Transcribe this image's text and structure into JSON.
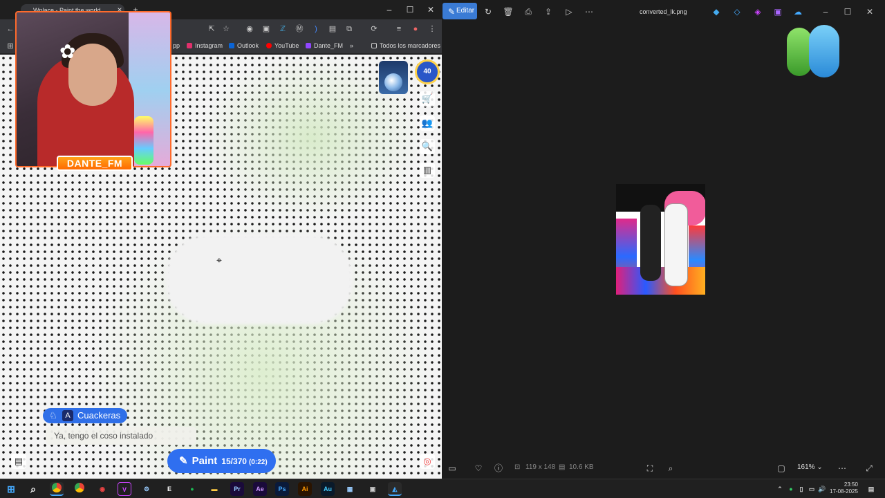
{
  "browser": {
    "tab_title": "Wplace - Paint the world",
    "bookmarks": [
      "Instagram",
      "Outlook",
      "YouTube",
      "Dante_FM"
    ],
    "all_bookmarks": "Todos los marcadores",
    "bookmark_partial": "pp"
  },
  "stream": {
    "streamer_label": "DANTE_FM"
  },
  "wplace": {
    "level": "40",
    "chat_user": "Cuackeras",
    "chat_message": "Ya, tengo el coso instalado",
    "paint_label": "Paint",
    "paint_count": "15/370",
    "paint_timer": "(0:22)"
  },
  "viewer": {
    "edit_label": "Editar",
    "file_name": "converted_lk.png",
    "dimensions": "119 x 148",
    "file_size": "10.6 KB",
    "zoom": "161%"
  },
  "taskbar": {
    "time": "23:50",
    "date": "17-08-2025"
  },
  "colors": {
    "accent_blue": "#2f6ff0",
    "webcam_border": "#ff6a2b",
    "edit_button": "#3a7bd5"
  }
}
